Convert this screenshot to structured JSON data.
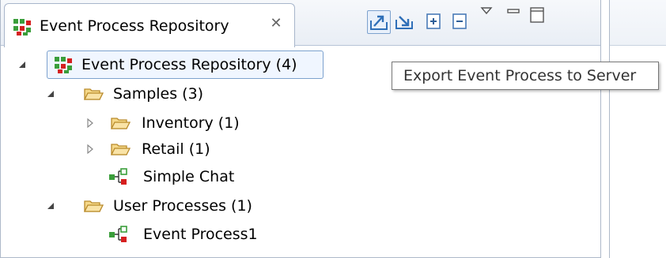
{
  "view": {
    "title": "Event Process Repository",
    "close_icon": "close-icon",
    "toolbar": [
      {
        "name": "export-to-server-button",
        "icon": "export-icon",
        "active": true
      },
      {
        "name": "import-from-server-button",
        "icon": "import-icon",
        "active": false
      },
      {
        "name": "expand-all-button",
        "icon": "expand-all-icon",
        "active": false
      },
      {
        "name": "collapse-all-button",
        "icon": "collapse-all-icon",
        "active": false
      },
      {
        "name": "view-menu-button",
        "icon": "chevron-down-icon",
        "active": false
      },
      {
        "name": "minimize-button",
        "icon": "minimize-icon",
        "active": false
      },
      {
        "name": "maximize-button",
        "icon": "maximize-icon",
        "active": false
      }
    ]
  },
  "tree": {
    "root": "Event Process Repository (4)",
    "samples": "Samples (3)",
    "inventory": "Inventory (1)",
    "retail": "Retail (1)",
    "simple_chat": "Simple Chat",
    "user_processes": "User Processes (1)",
    "event_process1": "Event Process1"
  },
  "tooltip": "Export Event Process to Server",
  "colors": {
    "folder": "#f5d889",
    "folder_stroke": "#b98a2a",
    "process_green": "#3a9e3a",
    "process_red": "#d61f1f",
    "selection_border": "#7da2ce",
    "tab_border": "#a8b6cb"
  }
}
